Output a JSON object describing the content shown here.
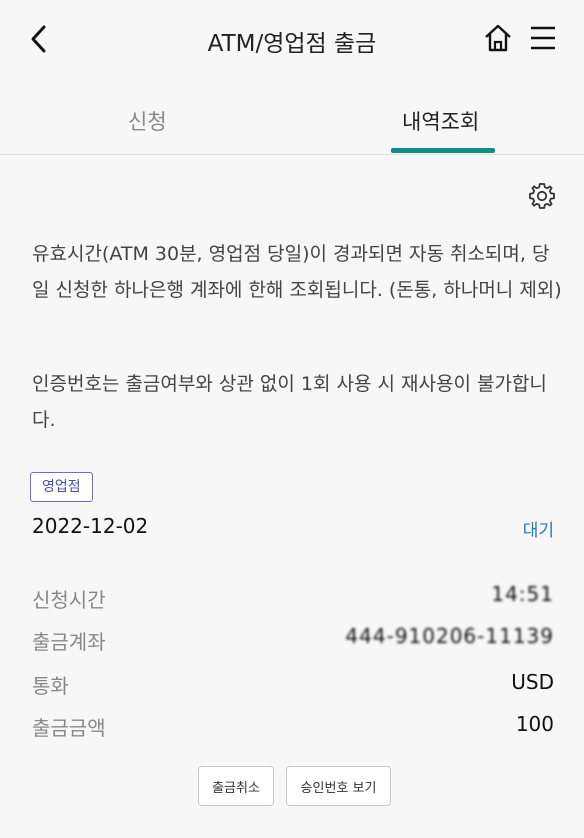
{
  "header": {
    "title": "ATM/영업점 출금"
  },
  "tabs": [
    {
      "label": "신청",
      "active": false
    },
    {
      "label": "내역조회",
      "active": true
    }
  ],
  "notices": [
    "유효시간(ATM 30분, 영업점 당일)이 경과되면 자동 취소되며, 당일 신청한 하나은행 계좌에 한해 조회됩니다. (돈통, 하나머니 제외)",
    "인증번호는 출금여부와 상관 없이 1회 사용 시 재사용이 불가합니다."
  ],
  "record": {
    "badge": "영업점",
    "date": "2022-12-02",
    "status": "대기",
    "rows": [
      {
        "label": "신청시간",
        "value": "14:51"
      },
      {
        "label": "출금계좌",
        "value": "444-910206-11139"
      },
      {
        "label": "통화",
        "value": "USD"
      },
      {
        "label": "출금금액",
        "value": "100"
      }
    ]
  },
  "actions": {
    "cancel_label": "출금취소",
    "approval_label": "승인번호 보기"
  },
  "colors": {
    "accent": "#0f8d86",
    "status": "#1f7ac0",
    "badge": "#4b4db3"
  }
}
